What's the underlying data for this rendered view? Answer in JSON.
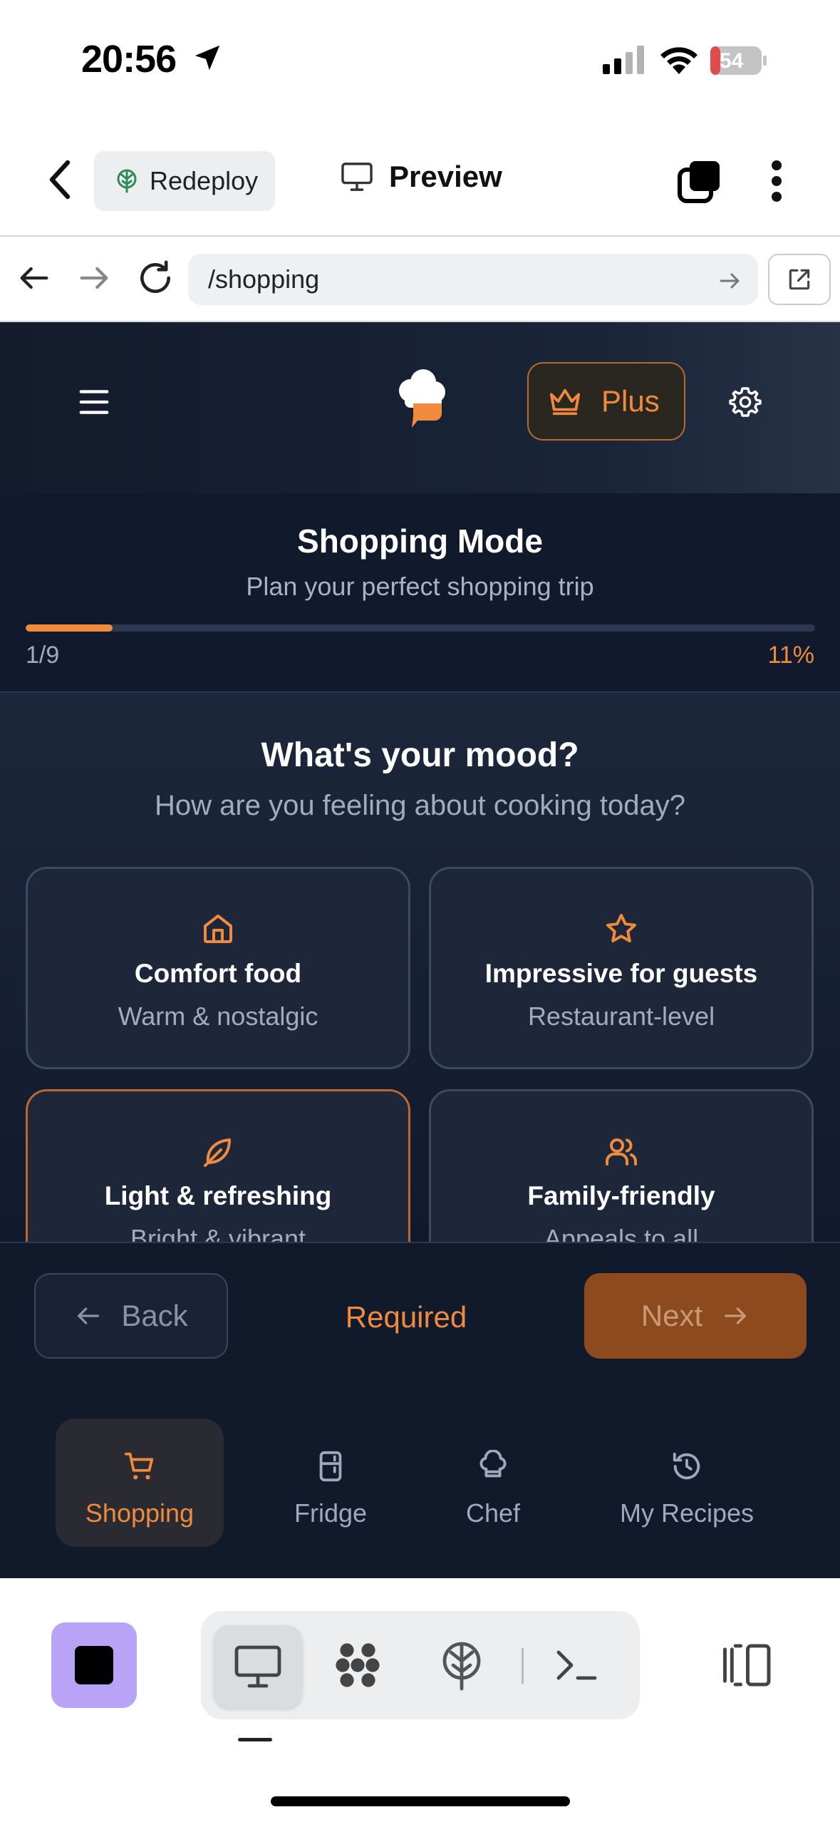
{
  "status_bar": {
    "time": "20:56",
    "battery": "54"
  },
  "top_bar": {
    "redeploy_label": "Redeploy",
    "preview_label": "Preview"
  },
  "url_bar": {
    "url": "/shopping"
  },
  "app": {
    "plus_label": "Plus",
    "mode_title": "Shopping Mode",
    "mode_subtitle": "Plan your perfect shopping trip",
    "progress": {
      "step_text": "1/9",
      "percent_text": "11%",
      "fraction": 0.11
    },
    "question": {
      "title": "What's your mood?",
      "subtitle": "How are you feeling about cooking today?"
    },
    "options": [
      {
        "icon": "home-icon",
        "title": "Comfort food",
        "desc": "Warm & nostalgic",
        "selected": false
      },
      {
        "icon": "star-icon",
        "title": "Impressive for guests",
        "desc": "Restaurant-level",
        "selected": false
      },
      {
        "icon": "leaf-icon",
        "title": "Light & refreshing",
        "desc": "Bright & vibrant",
        "selected": true
      },
      {
        "icon": "users-icon",
        "title": "Family-friendly",
        "desc": "Appeals to all",
        "selected": false
      }
    ],
    "footer": {
      "back_label": "Back",
      "required_label": "Required",
      "next_label": "Next"
    },
    "tabs": [
      {
        "icon": "cart-icon",
        "label": "Shopping",
        "active": true
      },
      {
        "icon": "fridge-icon",
        "label": "Fridge",
        "active": false
      },
      {
        "icon": "chef-hat-icon",
        "label": "Chef",
        "active": false
      },
      {
        "icon": "history-icon",
        "label": "My Recipes",
        "active": false
      }
    ]
  },
  "colors": {
    "accent": "#f08a3c",
    "app_background": "#111a2b",
    "stop_button": "#b9a3f7"
  }
}
